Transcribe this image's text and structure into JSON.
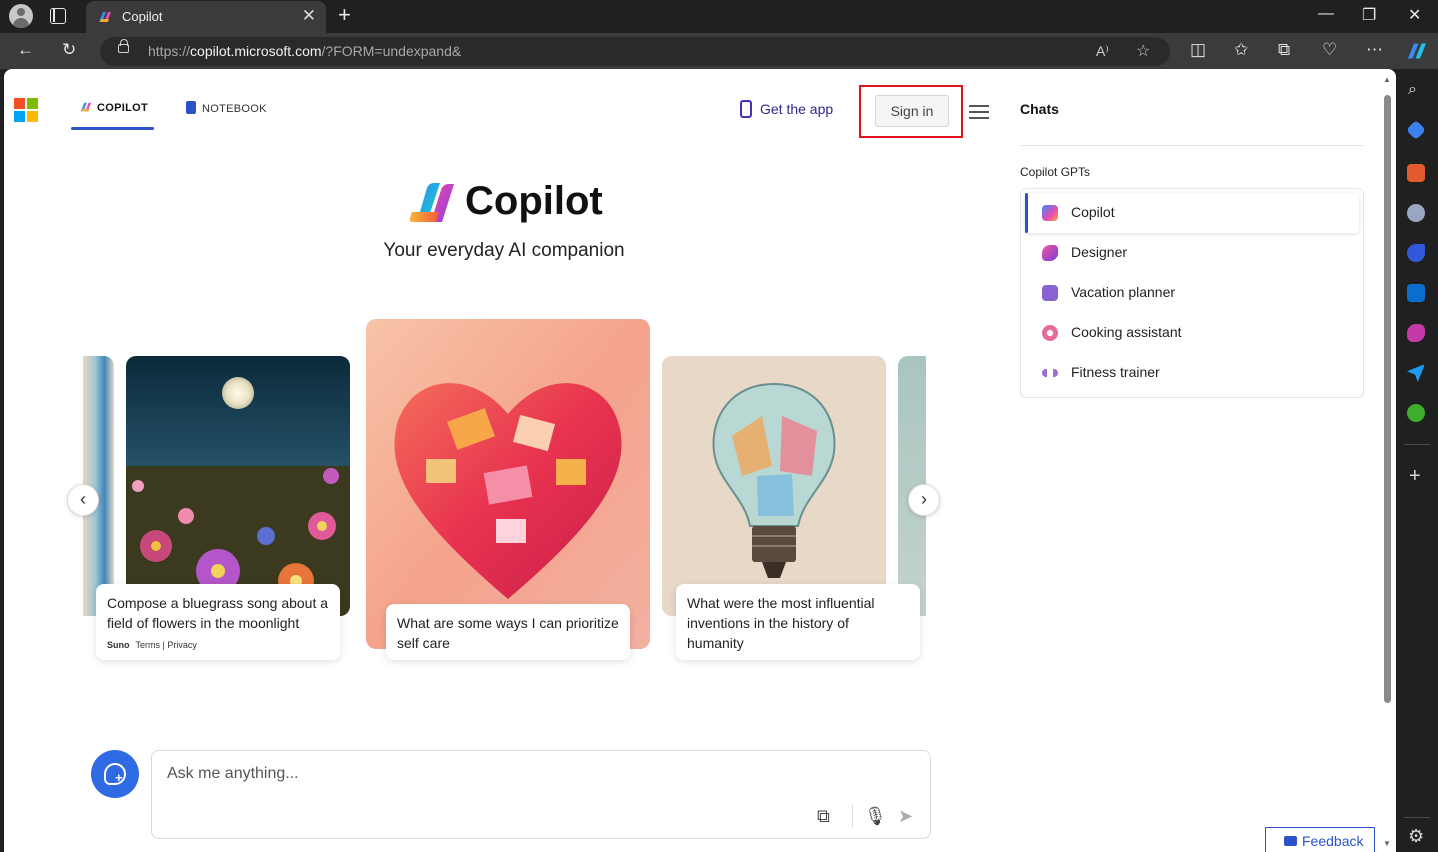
{
  "browser": {
    "tab_title": "Copilot",
    "close_tab": "✕",
    "new_tab": "+",
    "url_host": "copilot.microsoft.com",
    "url_prefix": "https://",
    "url_rest": "/?FORM=undexpand&",
    "window_min": "—",
    "window_restore": "❐",
    "window_close": "✕"
  },
  "nav": {
    "copilot_tab": "COPILOT",
    "notebook_tab": "NOTEBOOK",
    "get_app": "Get the app",
    "sign_in": "Sign in"
  },
  "hero": {
    "title": "Copilot",
    "subtitle": "Your everyday AI companion"
  },
  "carousel": {
    "cards": [
      {
        "text": "Compose a bluegrass song about a field of flowers in the moonlight",
        "brand": "Suno",
        "links": "Terms | Privacy"
      },
      {
        "text": "What are some ways I can prioritize self care"
      },
      {
        "text": "What were the most influential inventions in the history of humanity"
      }
    ],
    "prev": "‹",
    "next": "›"
  },
  "ask": {
    "placeholder": "Ask me anything..."
  },
  "chats": {
    "title": "Chats",
    "gpts_label": "Copilot GPTs",
    "items": [
      {
        "label": "Copilot",
        "color": "#4a8cf7"
      },
      {
        "label": "Designer",
        "color": "#d63aa8"
      },
      {
        "label": "Vacation planner",
        "color": "#8a63d2"
      },
      {
        "label": "Cooking assistant",
        "color": "#e86a9a"
      },
      {
        "label": "Fitness trainer",
        "color": "#9b6fd6"
      }
    ]
  },
  "feedback": "Feedback",
  "colors": {
    "accent": "#2b52c8",
    "highlight_box": "#e0131e",
    "ask_button": "#2f6ae5"
  }
}
